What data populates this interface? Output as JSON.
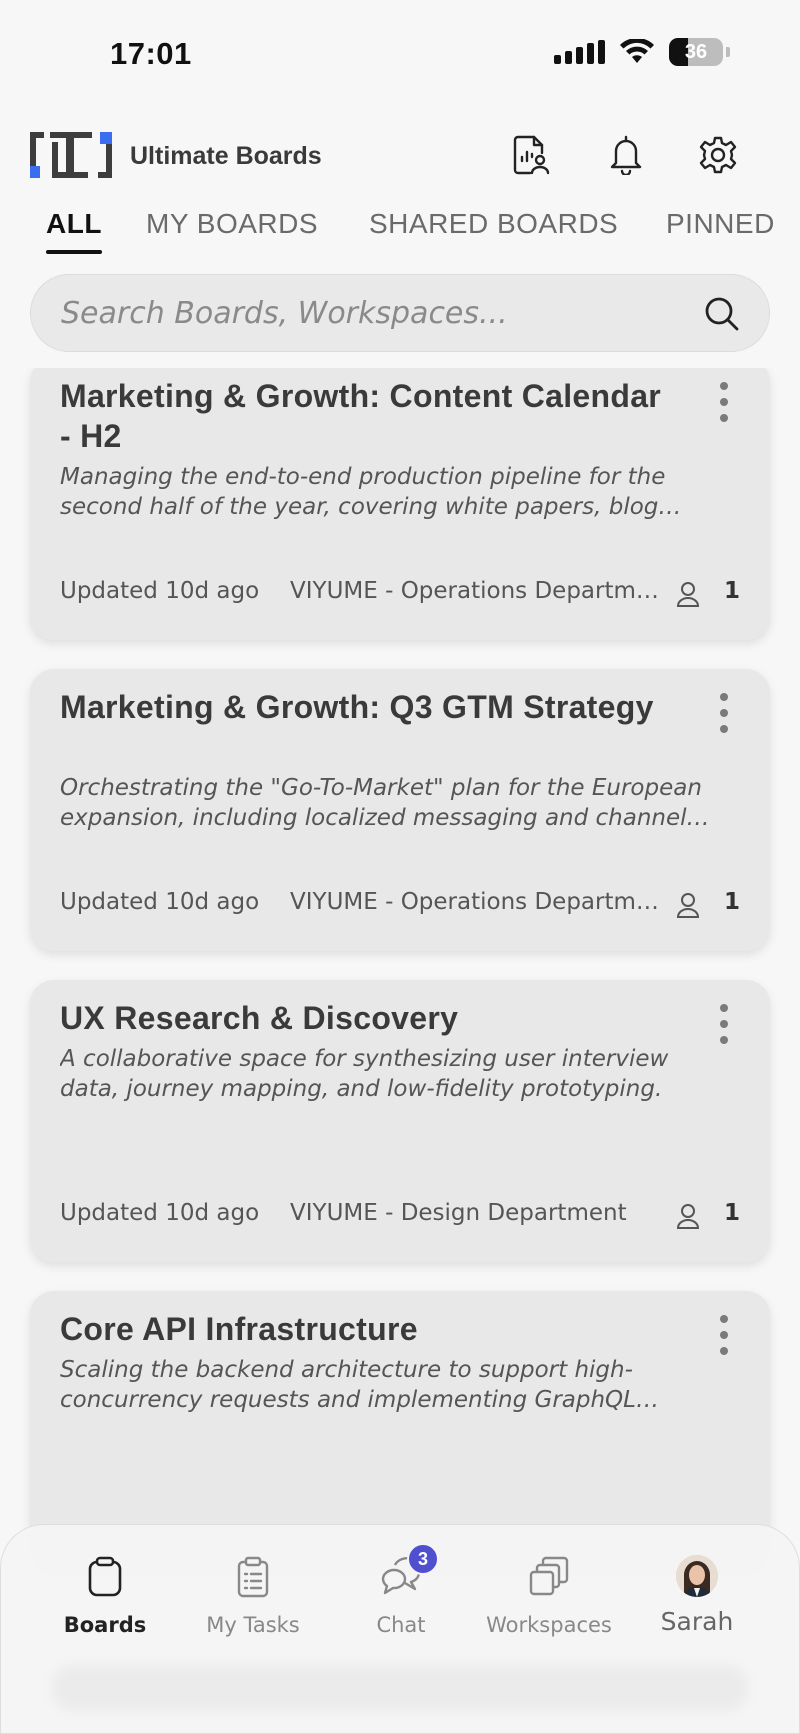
{
  "status_bar": {
    "time": "17:01",
    "battery_level": "36"
  },
  "header": {
    "app_name": "Ultimate Boards",
    "icons": [
      "reports-user-icon",
      "bell-icon",
      "gear-icon"
    ]
  },
  "tabs": [
    {
      "label": "ALL",
      "active": true
    },
    {
      "label": "MY BOARDS",
      "active": false
    },
    {
      "label": "SHARED BOARDS",
      "active": false
    },
    {
      "label": "PINNED",
      "active": false
    }
  ],
  "search": {
    "placeholder": "Search Boards, Workspaces..."
  },
  "boards": [
    {
      "title": "Marketing & Growth: Content Calendar - H2",
      "description": "Managing the end-to-end production pipeline for the second half of the year, covering white papers, blog posts and campaign assets.",
      "updated": "Updated 10d ago",
      "workspace": "VIYUME - Operations Department",
      "members": "1"
    },
    {
      "title": "Marketing & Growth: Q3 GTM Strategy",
      "description": "Orchestrating the \"Go-To-Market\" plan for the European expansion, including localized messaging and channel planning.",
      "updated": "Updated 10d ago",
      "workspace": "VIYUME - Operations Department",
      "members": "1"
    },
    {
      "title": "UX Research & Discovery",
      "description": "A collaborative space for synthesizing user interview data, journey mapping, and low-fidelity prototyping.",
      "updated": "Updated 10d ago",
      "workspace": "VIYUME - Design Department",
      "members": "1"
    },
    {
      "title": "Core API Infrastructure",
      "description": "Scaling the backend architecture to support high-concurrency requests and implementing GraphQL gateways.",
      "updated": "",
      "workspace": "",
      "members": ""
    }
  ],
  "bottom_nav": {
    "items": [
      {
        "label": "Boards",
        "icon": "boards-icon",
        "active": true
      },
      {
        "label": "My Tasks",
        "icon": "clipboard-icon",
        "active": false
      },
      {
        "label": "Chat",
        "icon": "chat-icon",
        "active": false,
        "badge": "3"
      },
      {
        "label": "Workspaces",
        "icon": "workspaces-icon",
        "active": false
      },
      {
        "label": "Sarah",
        "icon": "avatar",
        "active": false
      }
    ]
  },
  "colors": {
    "accent_blue": "#3b6df0",
    "badge": "#4f4fcf",
    "card_bg": "#e8e8e8"
  }
}
